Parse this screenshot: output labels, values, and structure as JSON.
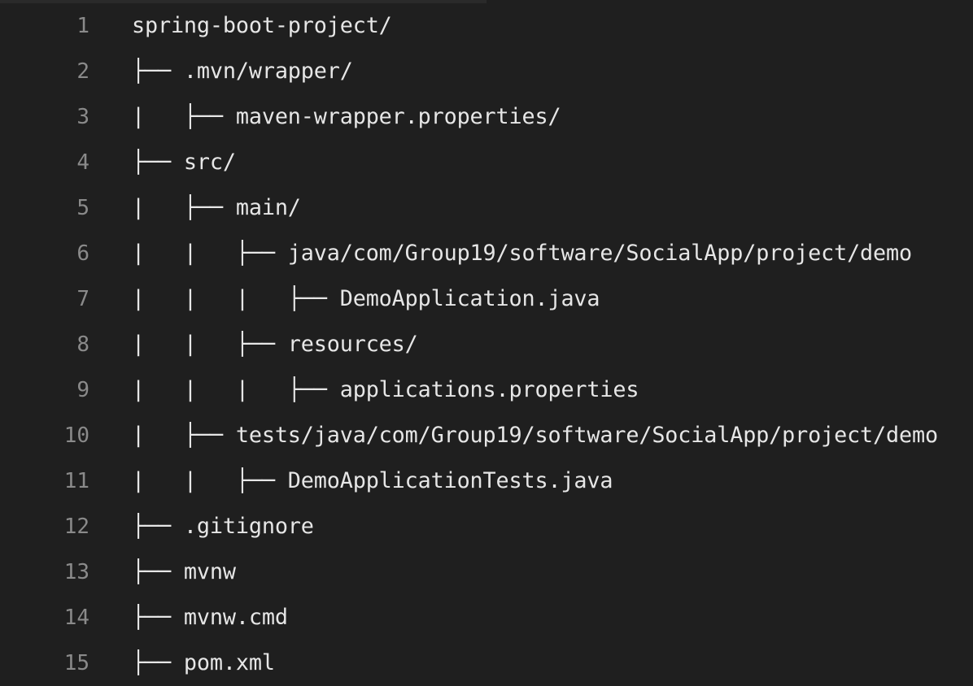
{
  "editor": {
    "lines": [
      {
        "number": "1",
        "text": "spring-boot-project/"
      },
      {
        "number": "2",
        "text": "├── .mvn/wrapper/"
      },
      {
        "number": "3",
        "text": "|   ├── maven-wrapper.properties/"
      },
      {
        "number": "4",
        "text": "├── src/"
      },
      {
        "number": "5",
        "text": "|   ├── main/"
      },
      {
        "number": "6",
        "text": "|   |   ├── java/com/Group19/software/SocialApp/project/demo"
      },
      {
        "number": "7",
        "text": "|   |   |   ├── DemoApplication.java"
      },
      {
        "number": "8",
        "text": "|   |   ├── resources/"
      },
      {
        "number": "9",
        "text": "|   |   |   ├── applications.properties"
      },
      {
        "number": "10",
        "text": "|   ├── tests/java/com/Group19/software/SocialApp/project/demo"
      },
      {
        "number": "11",
        "text": "|   |   ├── DemoApplicationTests.java"
      },
      {
        "number": "12",
        "text": "├── .gitignore"
      },
      {
        "number": "13",
        "text": "├── mvnw"
      },
      {
        "number": "14",
        "text": "├── mvnw.cmd"
      },
      {
        "number": "15",
        "text": "├── pom.xml"
      }
    ]
  }
}
